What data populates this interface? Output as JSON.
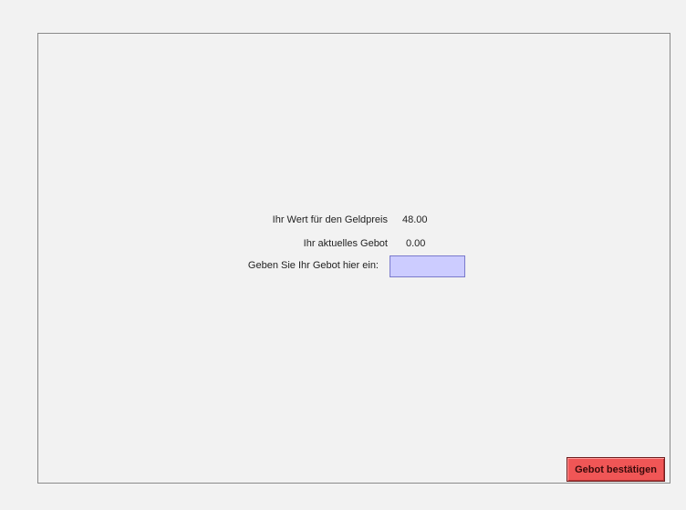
{
  "form": {
    "value_label": "Ihr Wert für den Geldpreis",
    "value_amount": "48.00",
    "current_bid_label": "Ihr aktuelles Gebot",
    "current_bid_amount": "0.00",
    "enter_bid_label": "Geben Sie Ihr Gebot hier ein:",
    "bid_input_value": ""
  },
  "actions": {
    "confirm_label": "Gebot bestätigen"
  },
  "colors": {
    "input_background": "#ccccff",
    "confirm_button": "#f05656"
  }
}
